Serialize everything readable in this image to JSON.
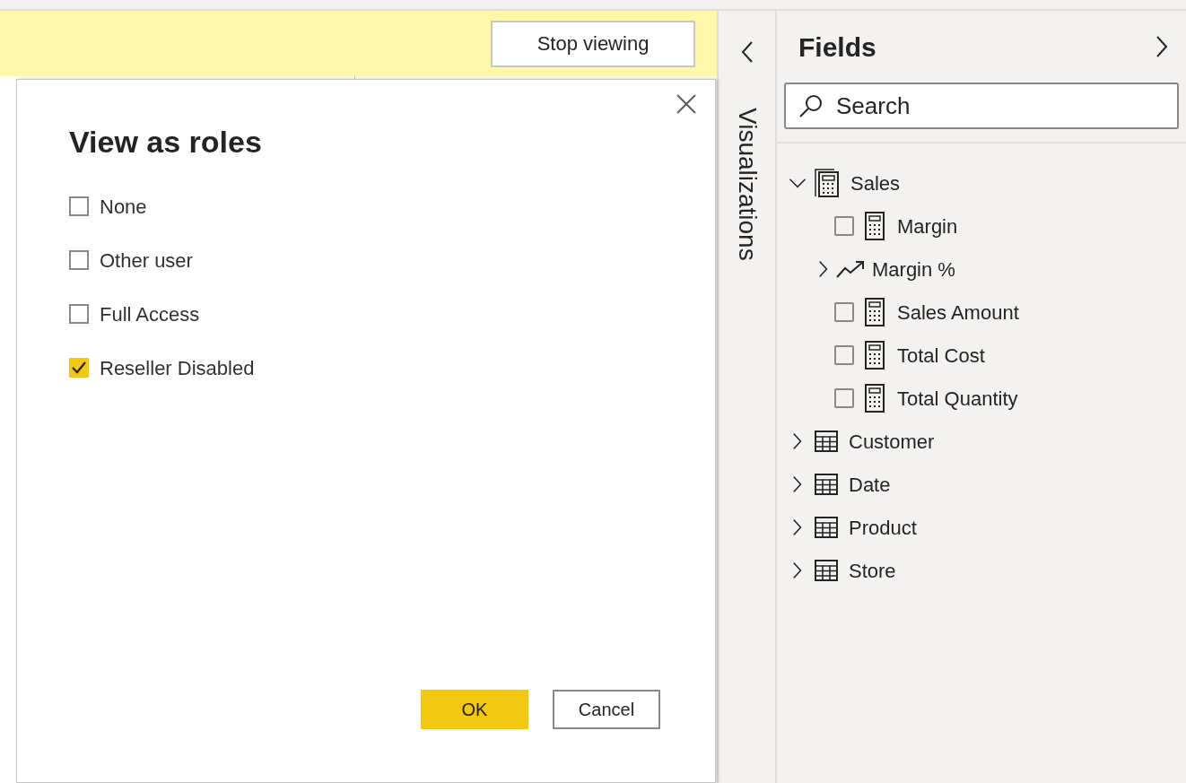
{
  "banner": {
    "button": "Stop viewing"
  },
  "dialog": {
    "title": "View as roles",
    "roles": [
      {
        "label": "None",
        "checked": false
      },
      {
        "label": "Other user",
        "checked": false
      },
      {
        "label": "Full Access",
        "checked": false
      },
      {
        "label": "Reseller Disabled",
        "checked": true
      }
    ],
    "buttons": [
      {
        "label": "OK",
        "kind": "primary"
      },
      {
        "label": "Cancel",
        "kind": "secondary"
      }
    ]
  },
  "visualizations_pane": {
    "title": "Visualizations"
  },
  "fields_pane": {
    "title": "Fields",
    "search": {
      "placeholder": "Search"
    },
    "tables": [
      {
        "name": "Sales",
        "kind": "measure-table",
        "expanded": true,
        "children": [
          {
            "name": "Margin",
            "kind": "measure",
            "checked": false
          },
          {
            "name": "Margin %",
            "kind": "kpi",
            "expanded": false
          },
          {
            "name": "Sales Amount",
            "kind": "measure",
            "checked": false
          },
          {
            "name": "Total Cost",
            "kind": "measure",
            "checked": false
          },
          {
            "name": "Total Quantity",
            "kind": "measure",
            "checked": false
          }
        ]
      },
      {
        "name": "Customer",
        "kind": "table",
        "expanded": false
      },
      {
        "name": "Date",
        "kind": "table",
        "expanded": false
      },
      {
        "name": "Product",
        "kind": "table",
        "expanded": false
      },
      {
        "name": "Store",
        "kind": "table",
        "expanded": false
      }
    ]
  }
}
